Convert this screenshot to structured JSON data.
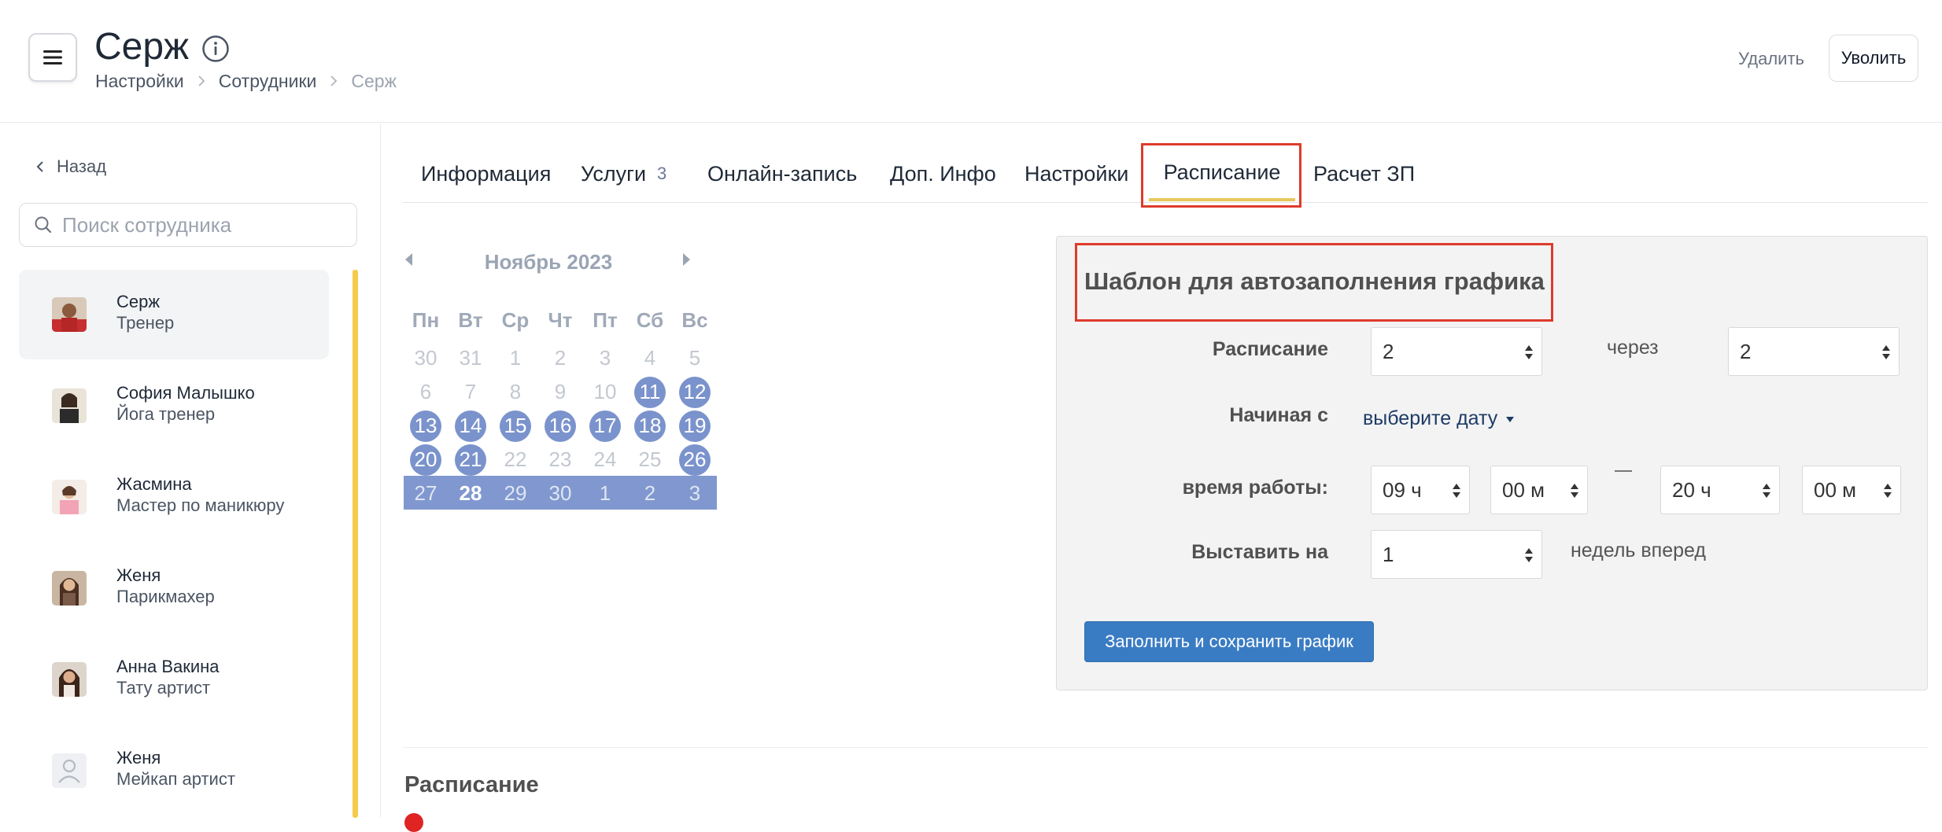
{
  "header": {
    "title": "Серж",
    "breadcrumb": [
      "Настройки",
      "Сотрудники",
      "Серж"
    ],
    "delete_label": "Удалить",
    "fire_label": "Уволить"
  },
  "sidebar": {
    "back_label": "Назад",
    "search_placeholder": "Поиск сотрудника",
    "employees": [
      {
        "name": "Серж",
        "role": "Тренер",
        "active": true
      },
      {
        "name": "София Малышко",
        "role": "Йога тренер"
      },
      {
        "name": "Жасмина",
        "role": "Мастер по маникюру"
      },
      {
        "name": "Женя",
        "role": "Парикмахер"
      },
      {
        "name": "Анна Вакина",
        "role": "Тату артист"
      },
      {
        "name": "Женя",
        "role": "Мейкап артист"
      }
    ]
  },
  "tabs": [
    {
      "label": "Информация"
    },
    {
      "label": "Услуги",
      "count": "3"
    },
    {
      "label": "Онлайн-запись"
    },
    {
      "label": "Доп. Инфо"
    },
    {
      "label": "Настройки"
    },
    {
      "label": "Расписание",
      "active": true
    },
    {
      "label": "Расчет ЗП"
    }
  ],
  "calendar": {
    "month_label": "Ноябрь 2023",
    "weekdays": [
      "Пн",
      "Вт",
      "Ср",
      "Чт",
      "Пт",
      "Сб",
      "Вс"
    ],
    "weeks": [
      [
        "30",
        "31",
        "1",
        "2",
        "3",
        "4",
        "5"
      ],
      [
        "6",
        "7",
        "8",
        "9",
        "10",
        "11",
        "12"
      ],
      [
        "13",
        "14",
        "15",
        "16",
        "17",
        "18",
        "19"
      ],
      [
        "20",
        "21",
        "22",
        "23",
        "24",
        "25",
        "26"
      ],
      [
        "27",
        "28",
        "29",
        "30",
        "1",
        "2",
        "3"
      ]
    ],
    "scheduled_days": [
      "11",
      "12",
      "13",
      "14",
      "15",
      "16",
      "17",
      "18",
      "19",
      "20",
      "21",
      "26"
    ],
    "today": "28"
  },
  "template": {
    "title": "Шаблон для автозаполнения графика",
    "schedule_label": "Расписание",
    "schedule_value": "2",
    "through_label": "через",
    "through_value": "2",
    "start_label": "Начиная с",
    "start_value": "выберите дату",
    "worktime_label": "время работы:",
    "start_hour": "09 ч",
    "start_min": "00 м",
    "end_hour": "20 ч",
    "end_min": "00 м",
    "apply_label": "Выставить на",
    "apply_value": "1",
    "weeks_ahead_label": "недель вперед",
    "fill_button": "Заполнить и сохранить график"
  },
  "schedule_section": {
    "heading": "Расписание"
  },
  "colors": {
    "accent_yellow": "#f5cb4b",
    "highlight_red": "#de3b2b",
    "calendar_blue": "#7b93cc",
    "button_blue": "#3a7cc4"
  }
}
